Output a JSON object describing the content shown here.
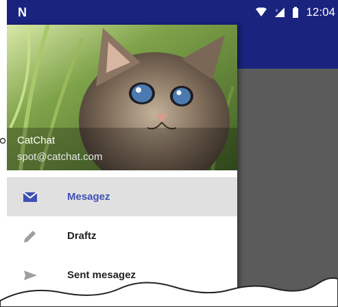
{
  "status_bar": {
    "logo": "N",
    "time": "12:04",
    "icons": [
      "wifi-icon",
      "signal-icon",
      "battery-icon"
    ]
  },
  "drawer": {
    "header": {
      "app_name": "CatChat",
      "email": "spot@catchat.com",
      "image": "kitten-photo"
    },
    "items": [
      {
        "label": "Mesagez",
        "icon": "envelope-icon",
        "selected": true
      },
      {
        "label": "Draftz",
        "icon": "pencil-icon",
        "selected": false
      },
      {
        "label": "Sent mesagez",
        "icon": "send-icon",
        "selected": false
      }
    ]
  },
  "colors": {
    "primary": "#1a237e",
    "accent": "#3f51b5",
    "selected_bg": "#e0e0e0",
    "scrim": "#5b5b5b"
  }
}
